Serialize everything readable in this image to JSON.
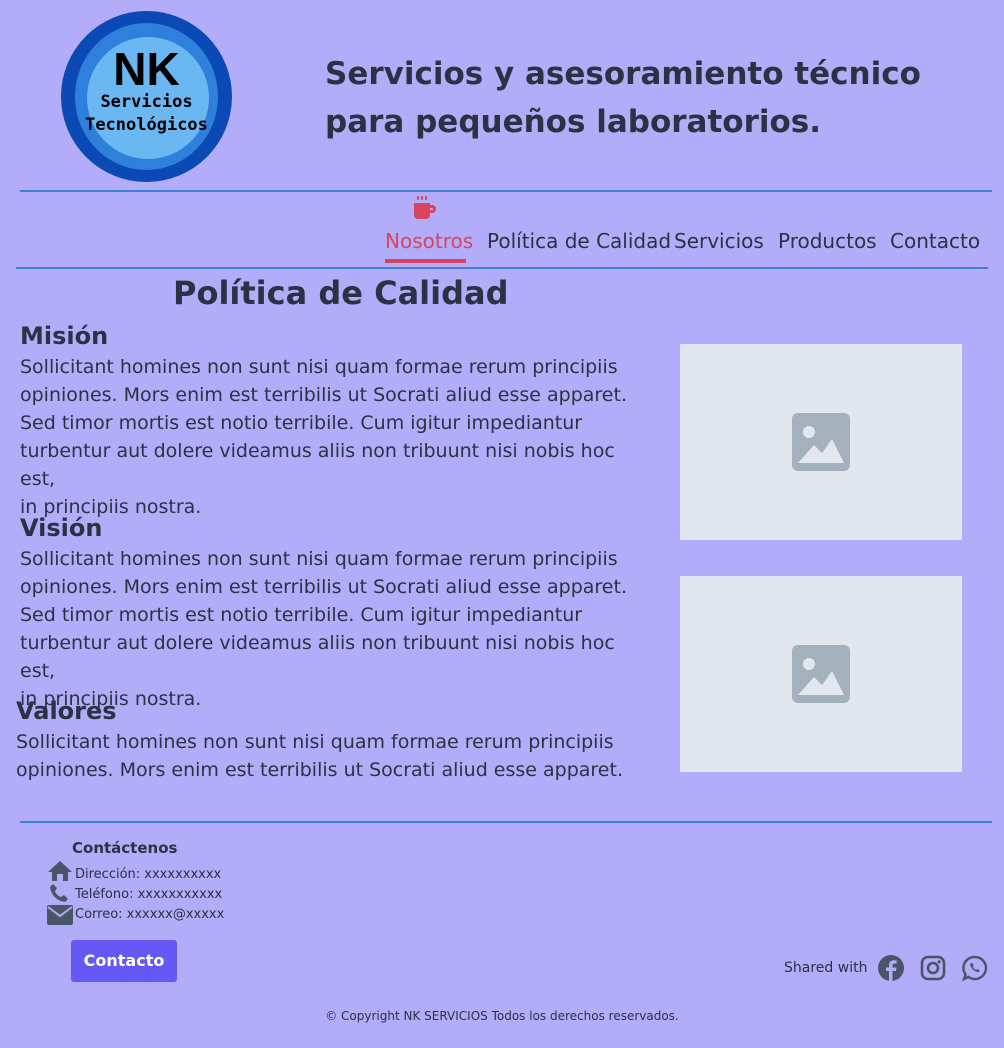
{
  "header": {
    "logo": {
      "line1": "NK",
      "line2": "Servicios",
      "line3": "Tecnológicos"
    },
    "tagline_line1": "Servicios y asesoramiento técnico",
    "tagline_line2": "para pequeños laboratorios."
  },
  "nav": {
    "active_icon": "coffee-cup-icon",
    "items": [
      {
        "label": "Nosotros",
        "active": true
      },
      {
        "label": "Política de Calidad",
        "active": false
      },
      {
        "label": "Servicios",
        "active": false
      },
      {
        "label": "Productos",
        "active": false
      },
      {
        "label": "Contacto",
        "active": false
      }
    ]
  },
  "main": {
    "title": "Política de Calidad",
    "sections": [
      {
        "heading": "Misión",
        "lines": [
          "Sollicitant homines non sunt nisi quam formae rerum principiis",
          "opiniones. Mors enim est terribilis ut Socrati aliud esse apparet.",
          "Sed timor mortis est notio terribile. Cum igitur impediantur",
          "turbentur aut dolere videamus aliis non tribuunt nisi nobis hoc est,",
          "in principiis nostra."
        ]
      },
      {
        "heading": "Visión",
        "lines": [
          "Sollicitant homines non sunt nisi quam formae rerum principiis",
          "opiniones. Mors enim est terribilis ut Socrati aliud esse apparet.",
          "Sed timor mortis est notio terribile. Cum igitur impediantur",
          "turbentur aut dolere videamus aliis non tribuunt nisi nobis hoc est,",
          "in principiis nostra."
        ]
      },
      {
        "heading": "Valores",
        "lines": [
          "Sollicitant homines non sunt nisi quam formae rerum principiis",
          "opiniones. Mors enim est terribilis ut Socrati aliud esse apparet."
        ]
      }
    ],
    "images": [
      {
        "icon": "image-placeholder-icon"
      },
      {
        "icon": "image-placeholder-icon"
      }
    ]
  },
  "footer": {
    "title": "Contáctenos",
    "address": "Dirección: xxxxxxxxxx",
    "phone": "Teléfono: xxxxxxxxxxx",
    "email": "Correo: xxxxxx@xxxxx",
    "contact_button": "Contacto",
    "shared_with": "Shared with",
    "social_icons": [
      "facebook-icon",
      "instagram-icon",
      "whatsapp-icon"
    ],
    "copyright": "© Copyright NK SERVICIOS Todos los derechos reservados."
  },
  "colors": {
    "background": "#b3acf8",
    "text": "#2a3244",
    "accent_red": "#d8435f",
    "line_blue": "#3b7fd6",
    "button": "#6558f5",
    "placeholder": "#e1e6ef"
  }
}
